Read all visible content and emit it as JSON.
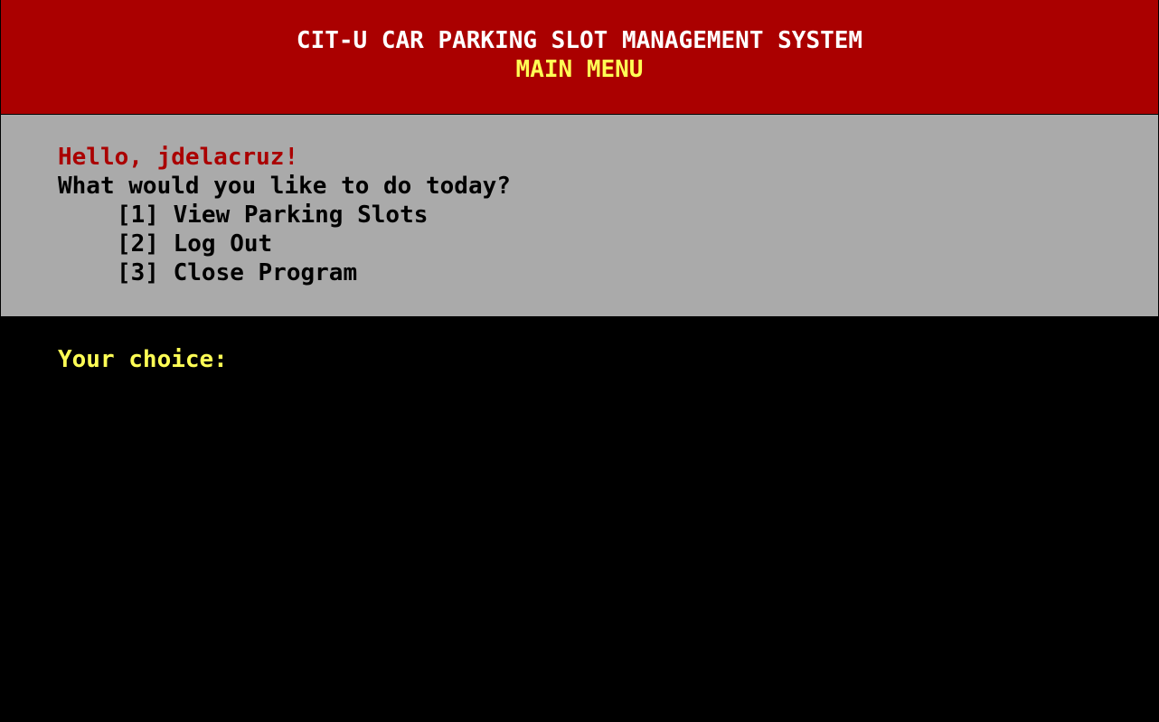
{
  "header": {
    "title": "CIT-U CAR PARKING SLOT MANAGEMENT SYSTEM",
    "subtitle": "MAIN MENU"
  },
  "menu": {
    "greeting": "Hello, jdelacruz!",
    "question": "What would you like to do today?",
    "options": [
      {
        "label": "[1] View Parking Slots"
      },
      {
        "label": "[2] Log Out"
      },
      {
        "label": "[3] Close Program"
      }
    ]
  },
  "input": {
    "prompt": "Your choice:",
    "value": ""
  },
  "colors": {
    "header_bg": "#aa0000",
    "title_text": "#ffffff",
    "subtitle_text": "#ffff55",
    "panel_bg": "#aaaaaa",
    "greeting_text": "#aa0000",
    "menu_text": "#000000",
    "console_bg": "#000000",
    "prompt_text": "#ffff55"
  }
}
